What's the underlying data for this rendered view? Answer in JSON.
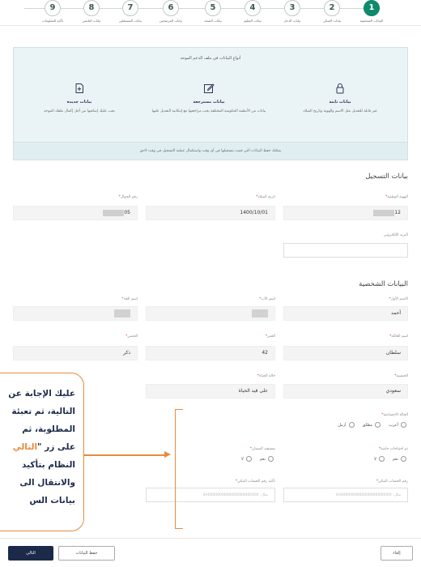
{
  "stepper": {
    "steps": [
      {
        "num": "1",
        "label": "البيانات الشخصية",
        "active": true
      },
      {
        "num": "2",
        "label": "بيانات السكن"
      },
      {
        "num": "3",
        "label": "بيانات الدخل"
      },
      {
        "num": "4",
        "label": "بيانات التعليم"
      },
      {
        "num": "5",
        "label": "بيانات الصحة"
      },
      {
        "num": "6",
        "label": "بيانات المرشحين"
      },
      {
        "num": "7",
        "label": "بيانات المستقلين"
      },
      {
        "num": "8",
        "label": "بيانات التابعين"
      },
      {
        "num": "9",
        "label": "تأكيد المعلومات"
      }
    ]
  },
  "info": {
    "title": "أنواع البيانات في ملف الدعم الموحد",
    "cols": [
      {
        "heading": "بيانات ثابتة",
        "desc": "غير قابلة للتعديل مثل الاسم والهوية وتاريخ الميلاد",
        "icon": "lock-icon"
      },
      {
        "heading": "بيانات مسترجعة",
        "desc": "بيانات من الأنظمة الحكومية المختلفة يجب مراجعتها مع إمكانية التعديل عليها",
        "icon": "edit-icon"
      },
      {
        "heading": "بيانات جديدة",
        "desc": "يجب عليك إضافتها من أجل إكمال ملفك الموحد",
        "icon": "new-file-icon"
      }
    ],
    "footer": "يمكنك حفظ البيانات التي قمت بتسجيلها في أي وقت واستكمال عملية التسجيل في وقت لاحق"
  },
  "registration": {
    "title": "بيانات التسجيل",
    "national_id_label": "الهوية الوطنية",
    "national_id_value": "12",
    "birth_label": "تاريخ الميلاد",
    "birth_value": "1400/10/01",
    "mobile_label": "رقم الجوال",
    "mobile_value": "05",
    "email_label": "البريد الإلكتروني"
  },
  "personal": {
    "title": "البيانات الشخصية",
    "first_name_label": "الاسم الأول",
    "first_name_value": "أحمد",
    "father_label": "اسم الأب",
    "grandfather_label": "اسم الجد",
    "family_label": "اسم العائلة",
    "family_value": "سلطان",
    "age_label": "العمر",
    "age_value": "42",
    "gender_label": "الجنس",
    "gender_value": "ذكر",
    "nationality_label": "الجنسية",
    "nationality_value": "سعودي",
    "life_status_label": "حالة الحياة",
    "life_status_value": "على قيد الحياة",
    "marital_label": "الحالة الاجتماعية",
    "marital_options": [
      "أعزب",
      "مطلق",
      "أرمل"
    ],
    "special_needs_label": "ذو احتياجات خاصة",
    "special_needs_options": [
      "نعم",
      "لا"
    ],
    "beneficiary_label": "مستفيد الضمان",
    "beneficiary_options": [
      "نعم",
      "لا"
    ],
    "iban_label": "رقم الحساب البنكي",
    "iban_placeholder": "مثال: SA0000000000000000000000",
    "iban_confirm_label": "تأكيد رقم الحساب البنكي",
    "iban_confirm_placeholder": "مثال: SA0000000000000000000000"
  },
  "callout": {
    "line1": "عليك الإجابة عن",
    "line2": "التالية، ثم تعبئة",
    "line3": "المطلوبة، ثم",
    "line4a": "على زر \"",
    "line4b": "التالي",
    "line5": "النظام بتأكيد",
    "line6": "والانتقال الى",
    "line7": "بيانات الس"
  },
  "footer": {
    "next": "التالي",
    "save": "حفظ البيانات",
    "cancel": "إلغاء"
  },
  "colors": {
    "primary": "#0f8a6c",
    "navy": "#1c2a4a",
    "accent": "#e88a3c"
  }
}
